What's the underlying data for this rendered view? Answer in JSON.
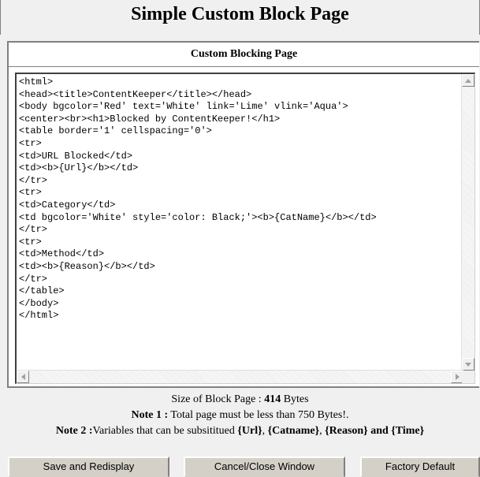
{
  "header": {
    "title": "Simple Custom Block Page"
  },
  "panel": {
    "heading": "Custom Blocking Page",
    "code_lines": [
      "<html>",
      "<head><title>ContentKeeper</title></head>",
      "<body bgcolor='Red' text='White' link='Lime' vlink='Aqua'>",
      "<center><br><h1>Blocked by ContentKeeper!</h1>",
      "<table border='1' cellspacing='0'>",
      "<tr>",
      "<td>URL Blocked</td>",
      "<td><b>{Url}</b></td>",
      "</tr>",
      "<tr>",
      "<td>Category</td>",
      "<td bgcolor='White' style='color: Black;'><b>{CatName}</b></td>",
      "</tr>",
      "<tr>",
      "<td>Method</td>",
      "<td><b>{Reason}</b></td>",
      "</tr>",
      "</table>",
      "</body>",
      "</html>"
    ]
  },
  "info": {
    "size_label": "Size of Block Page : ",
    "size_value": "414",
    "size_unit": " Bytes",
    "note1_label": "Note 1 :",
    "note1_text": " Total page must be less than 750 Bytes!.",
    "note2_label": "Note 2 :",
    "note2_text": "Variables that can be subsititued ",
    "var_url": "{Url}",
    "sep1": ", ",
    "var_catname": "{Catname}",
    "sep2": ", ",
    "var_reason": "{Reason}",
    "and_text": " and ",
    "var_time": "{Time}"
  },
  "buttons": {
    "save": "Save and Redisplay",
    "cancel": "Cancel/Close Window",
    "factory": "Factory Default"
  }
}
